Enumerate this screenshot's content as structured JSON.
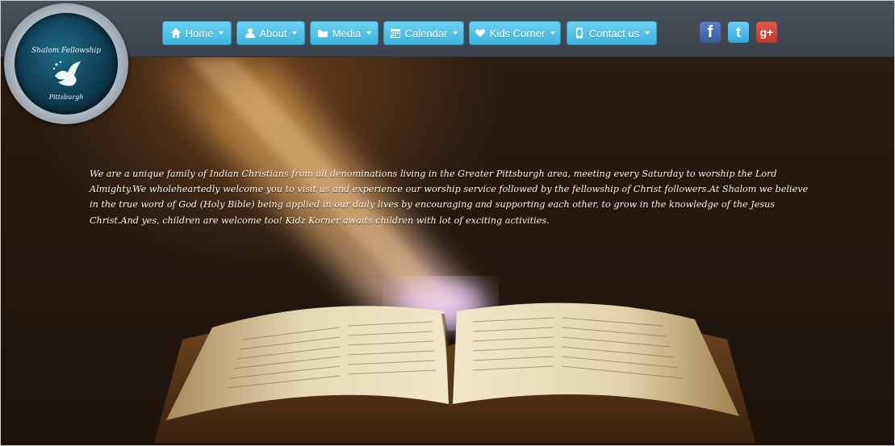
{
  "logo": {
    "line1": "Shalom Fellowship",
    "line2": "Pittsburgh"
  },
  "nav": {
    "items": [
      {
        "label": "Home",
        "icon": "home-icon"
      },
      {
        "label": "About",
        "icon": "user-icon"
      },
      {
        "label": "Media",
        "icon": "folder-icon"
      },
      {
        "label": "Calendar",
        "icon": "calendar-icon"
      },
      {
        "label": "Kids Corner",
        "icon": "heart-icon"
      },
      {
        "label": "Contact us",
        "icon": "phone-icon"
      }
    ]
  },
  "social": {
    "facebook": "f",
    "twitter": "t",
    "googleplus": "g+"
  },
  "intro": {
    "text": "We are a unique family of Indian Christians from all denominations living in the Greater Pittsburgh area, meeting every Saturday to worship the Lord Almighty.We wholeheartedly welcome you to visit us and experience our worship service followed by the fellowship of Christ followers.At Shalom we believe in the true word of God (Holy Bible) being applied in our daily lives by encouraging and supporting each other, to grow in the knowledge of the Jesus Christ.And yes, children are welcome too! Kidz Korner awaits children with lot of exciting activities."
  },
  "colors": {
    "navbar": "#434a53",
    "menu_button": "#4fc1e5",
    "facebook": "#3b5998",
    "twitter": "#2aa9e0",
    "googleplus": "#c0392b"
  }
}
